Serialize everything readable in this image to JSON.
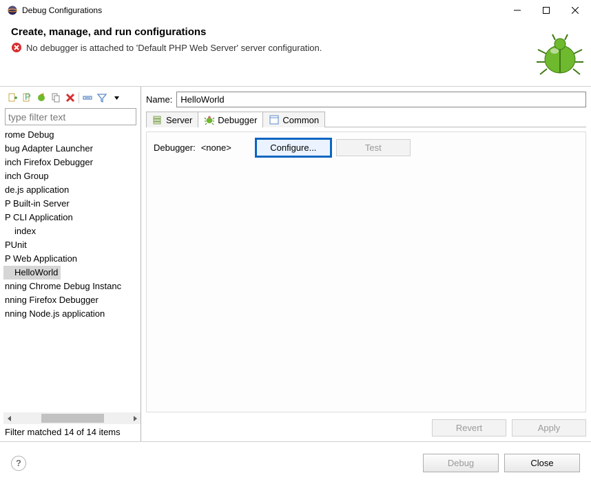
{
  "window": {
    "title": "Debug Configurations",
    "min": "–",
    "max": "▢",
    "close": "✕"
  },
  "banner": {
    "heading": "Create, manage, and run configurations",
    "error": "No debugger is attached to 'Default PHP Web Server' server configuration."
  },
  "left": {
    "filter_placeholder": "type filter text",
    "items": [
      {
        "label": "rome Debug",
        "indent": false
      },
      {
        "label": "bug Adapter Launcher",
        "indent": false
      },
      {
        "label": "inch Firefox Debugger",
        "indent": false
      },
      {
        "label": "inch Group",
        "indent": false
      },
      {
        "label": "de.js application",
        "indent": false
      },
      {
        "label": "P Built-in Server",
        "indent": false
      },
      {
        "label": "P CLI Application",
        "indent": false
      },
      {
        "label": "index",
        "indent": true
      },
      {
        "label": "PUnit",
        "indent": false
      },
      {
        "label": "P Web Application",
        "indent": false
      },
      {
        "label": "HelloWorld",
        "indent": true,
        "selected": true
      },
      {
        "label": "nning Chrome Debug Instanc",
        "indent": false
      },
      {
        "label": "nning Firefox Debugger",
        "indent": false
      },
      {
        "label": "nning Node.js application",
        "indent": false
      }
    ],
    "status": "Filter matched 14 of 14 items"
  },
  "form": {
    "name_label": "Name:",
    "name_value": "HelloWorld",
    "tabs": {
      "server": "Server",
      "debugger": "Debugger",
      "common": "Common"
    },
    "debugger_label": "Debugger:",
    "debugger_value": "<none>",
    "configure": "Configure...",
    "test": "Test",
    "revert": "Revert",
    "apply": "Apply"
  },
  "footer": {
    "help": "?",
    "debug": "Debug",
    "close": "Close"
  }
}
